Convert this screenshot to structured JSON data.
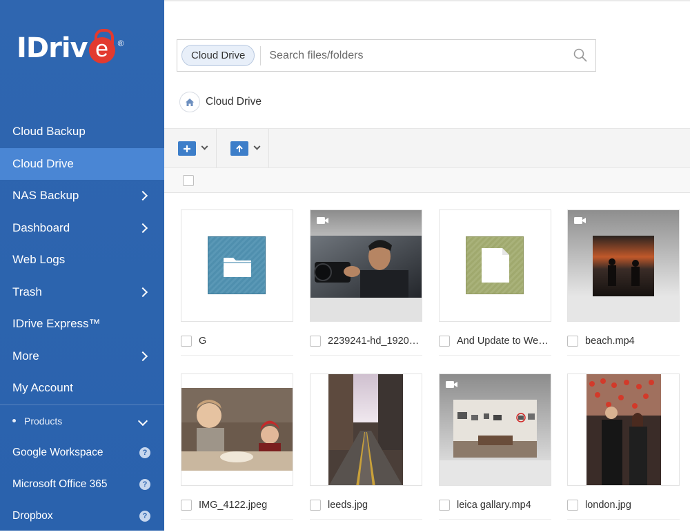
{
  "app": {
    "logo_text": "IDriv",
    "logo_e": "e",
    "logo_reg": "®"
  },
  "sidebar": {
    "items": [
      {
        "label": "Cloud Backup",
        "chevron": false,
        "active": false
      },
      {
        "label": "Cloud Drive",
        "chevron": false,
        "active": true
      },
      {
        "label": "NAS Backup",
        "chevron": true,
        "active": false
      },
      {
        "label": "Dashboard",
        "chevron": true,
        "active": false
      },
      {
        "label": "Web Logs",
        "chevron": false,
        "active": false
      },
      {
        "label": "Trash",
        "chevron": true,
        "active": false
      },
      {
        "label": "IDrive Express™",
        "chevron": false,
        "active": false
      },
      {
        "label": "More",
        "chevron": true,
        "active": false
      },
      {
        "label": "My Account",
        "chevron": false,
        "active": false
      }
    ],
    "products_label": "Products",
    "products": [
      {
        "label": "Google Workspace",
        "help": "?"
      },
      {
        "label": "Microsoft Office 365",
        "help": "?"
      },
      {
        "label": "Dropbox",
        "help": "?"
      }
    ]
  },
  "search": {
    "scope_label": "Cloud Drive",
    "placeholder": "Search files/folders"
  },
  "breadcrumb": {
    "label": "Cloud Drive"
  },
  "files": [
    {
      "name": "G",
      "kind": "folder"
    },
    {
      "name": "2239241-hd_1920_...",
      "kind": "video"
    },
    {
      "name": "And Update to Wee...",
      "kind": "document"
    },
    {
      "name": "beach.mp4",
      "kind": "video"
    },
    {
      "name": "IMG_4122.jpeg",
      "kind": "image"
    },
    {
      "name": "leeds.jpg",
      "kind": "image"
    },
    {
      "name": "leica gallary.mp4",
      "kind": "video"
    },
    {
      "name": "london.jpg",
      "kind": "image"
    }
  ],
  "colors": {
    "sidebar": "#2f66b0",
    "active_item": "#4a86d4",
    "accent": "#3d7ec9",
    "logo_red": "#e23a2f"
  }
}
